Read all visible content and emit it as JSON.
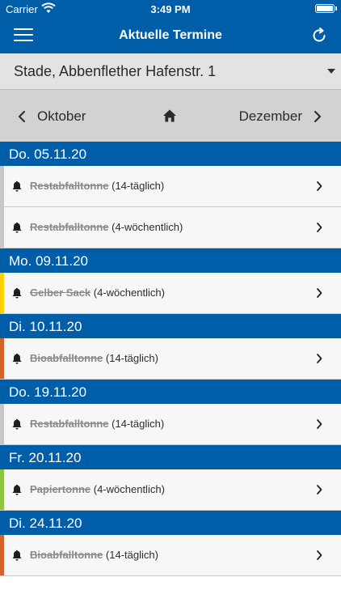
{
  "status_bar": {
    "carrier": "Carrier",
    "time": "3:49 PM",
    "icons": [
      "wifi-icon",
      "battery-icon"
    ]
  },
  "nav": {
    "title": "Aktuelle Termine",
    "icons": [
      "menu-icon",
      "refresh-icon"
    ]
  },
  "location": {
    "selected": "Stade, Abbenflether Hafenstr. 1"
  },
  "month_nav": {
    "prev_label": "Oktober",
    "next_label": "Dezember",
    "icons": [
      "chevron-left-icon",
      "home-icon",
      "chevron-right-icon"
    ]
  },
  "colors": {
    "header_blue": "#005da8",
    "restabfall": "#c8c8c8",
    "gelber_sack": "#ffd100",
    "bioabfall": "#d2642a",
    "papier": "#8cc63e"
  },
  "days": [
    {
      "date": "Do. 05.11.20",
      "items": [
        {
          "name": "Restabfalltonne",
          "interval": "(14-täglich)",
          "color": "#c8c8c8"
        },
        {
          "name": "Restabfalltonne",
          "interval": "(4-wöchentlich)",
          "color": "#c8c8c8"
        }
      ]
    },
    {
      "date": "Mo. 09.11.20",
      "items": [
        {
          "name": "Gelber Sack",
          "interval": "(4-wöchentlich)",
          "color": "#ffd100"
        }
      ]
    },
    {
      "date": "Di. 10.11.20",
      "items": [
        {
          "name": "Bioabfalltonne",
          "interval": "(14-täglich)",
          "color": "#d2642a"
        }
      ]
    },
    {
      "date": "Do. 19.11.20",
      "items": [
        {
          "name": "Restabfalltonne",
          "interval": "(14-täglich)",
          "color": "#c8c8c8"
        }
      ]
    },
    {
      "date": "Fr. 20.11.20",
      "items": [
        {
          "name": "Papiertonne",
          "interval": "(4-wöchentlich)",
          "color": "#8cc63e"
        }
      ]
    },
    {
      "date": "Di. 24.11.20",
      "items": [
        {
          "name": "Bioabfalltonne",
          "interval": "(14-täglich)",
          "color": "#d2642a"
        }
      ]
    }
  ]
}
